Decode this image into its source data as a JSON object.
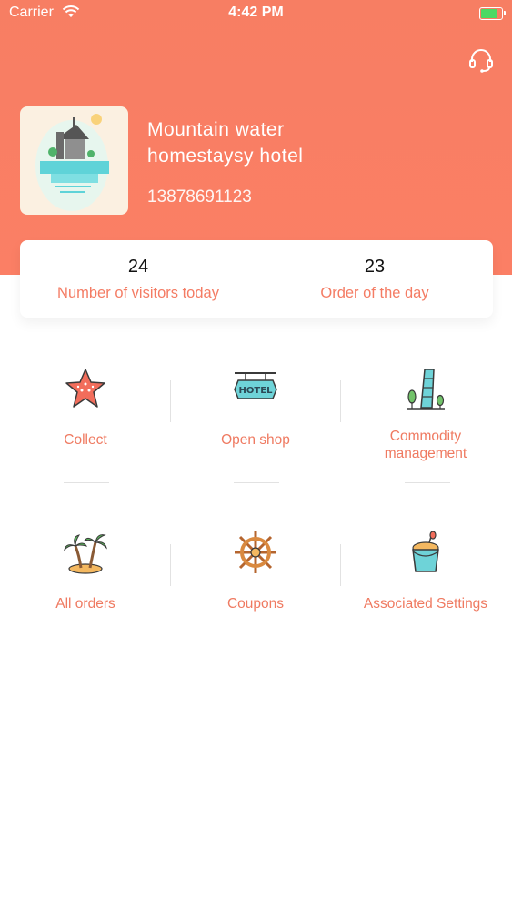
{
  "status_bar": {
    "carrier": "Carrier",
    "time": "4:42 PM"
  },
  "header": {
    "hotel_name": "Mountain  water\nhomestaysy hotel",
    "phone": "13878691123",
    "icons": {
      "support": "headset-icon",
      "avatar": "hotel-illustration"
    }
  },
  "stats": [
    {
      "value": "24",
      "label": "Number of visitors today"
    },
    {
      "value": "23",
      "label": "Order of the day"
    }
  ],
  "menu": [
    {
      "label": "Collect",
      "icon": "starfish-icon"
    },
    {
      "label": "Open shop",
      "icon": "hotel-sign-icon"
    },
    {
      "label": "Commodity\nmanagement",
      "icon": "leaning-tower-icon"
    },
    {
      "label": "All orders",
      "icon": "palm-island-icon"
    },
    {
      "label": "Coupons",
      "icon": "ship-wheel-icon"
    },
    {
      "label": "Associated Settings",
      "icon": "sand-bucket-icon"
    }
  ],
  "colors": {
    "accent": "#fb7f65",
    "label": "#ef7a61",
    "battery": "#4cd964"
  }
}
